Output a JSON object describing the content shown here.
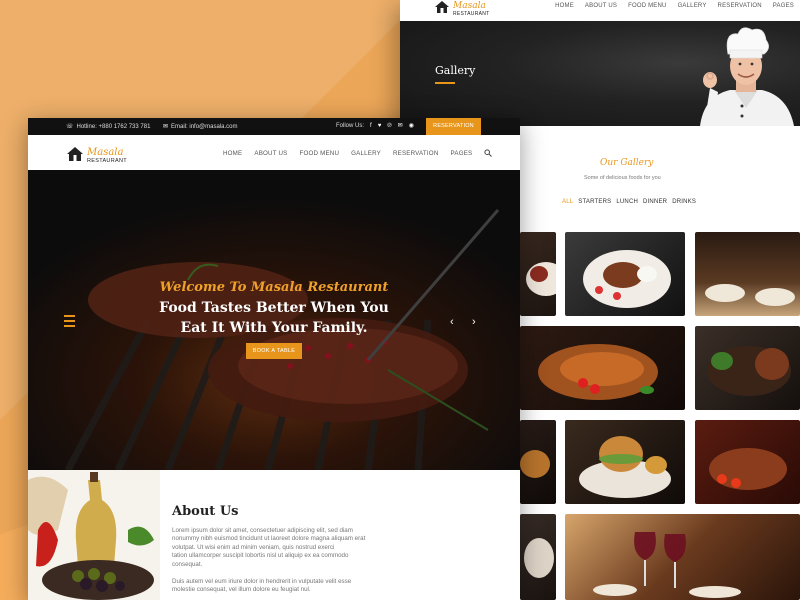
{
  "colors": {
    "accent": "#e8961b",
    "background": "#f5ad5c",
    "dark": "#111111"
  },
  "back_page": {
    "logo": {
      "brand": "Masala",
      "sub": "RESTAURANT"
    },
    "menu": [
      "HOME",
      "ABOUT US",
      "FOOD MENU",
      "GALLERY",
      "RESERVATION",
      "PAGES"
    ],
    "hero_title": "Gallery",
    "section_title": "Our Gallery",
    "section_subtitle": "Some of delicious foods for you",
    "filters": [
      "ALL",
      "STARTERS",
      "LUNCH",
      "DINNER",
      "DRINKS"
    ],
    "active_filter": "ALL"
  },
  "front_page": {
    "topbar": {
      "hotline": "Hotline: +880 1762 733 781",
      "email": "Email: info@masala.com",
      "follow": "Follow Us:",
      "reservation": "RESERVATION"
    },
    "logo": {
      "brand": "Masala",
      "sub": "RESTAURANT"
    },
    "menu": [
      "HOME",
      "ABOUT US",
      "FOOD MENU",
      "GALLERY",
      "RESERVATION",
      "PAGES"
    ],
    "hero": {
      "welcome": "Welcome To Masala Restaurant",
      "line1": "Food Tastes Better When You",
      "line2": "Eat It With Your Family.",
      "button": "BOOK A TABLE"
    },
    "about": {
      "title": "About Us",
      "p1_l1": "Lorem ipsum dolor sit amet, consectetuer adipiscing elit, sed diam",
      "p1_l2": "nonummy nibh euismod tincidunt ut laoreet dolore magna aliquam erat",
      "p1_l3": "volutpat. Ut wisi enim ad minim veniam, quis nostrud exerci",
      "p1_l4": "tation ullamcorper suscipit lobortis nisl ut aliquip ex ea commodo",
      "p1_l5": "consequat.",
      "p2_l1": "Duis autem vel eum iriure dolor in hendrerit in vulputate velit esse",
      "p2_l2": "molestie consequat, vel illum dolore eu feugiat nul."
    }
  }
}
